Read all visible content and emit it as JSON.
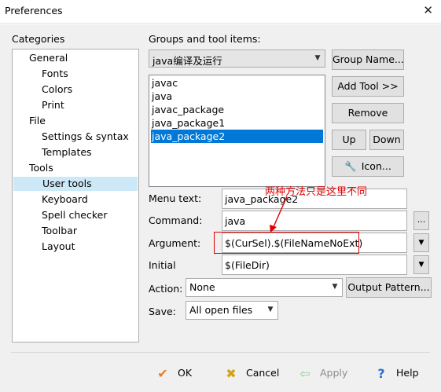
{
  "window": {
    "title": "Preferences",
    "close_glyph": "✕"
  },
  "categories": {
    "label": "Categories",
    "items": [
      {
        "label": "General",
        "level": 1
      },
      {
        "label": "Fonts",
        "level": 2
      },
      {
        "label": "Colors",
        "level": 2
      },
      {
        "label": "Print",
        "level": 2
      },
      {
        "label": "File",
        "level": 1
      },
      {
        "label": "Settings & syntax",
        "level": 2
      },
      {
        "label": "Templates",
        "level": 2
      },
      {
        "label": "Tools",
        "level": 1
      },
      {
        "label": "User tools",
        "level": 2,
        "selected": true
      },
      {
        "label": "Keyboard",
        "level": 2
      },
      {
        "label": "Spell checker",
        "level": 2
      },
      {
        "label": "Toolbar",
        "level": 2
      },
      {
        "label": "Layout",
        "level": 2
      }
    ]
  },
  "groups": {
    "label": "Groups and tool items:",
    "selected_group": "java编译及运行",
    "group_name_button": "Group Name...",
    "add_tool_button": "Add Tool >>",
    "remove_button": "Remove",
    "up_button": "Up",
    "down_button": "Down",
    "icon_button": "Icon...",
    "items": [
      {
        "label": "javac"
      },
      {
        "label": "java"
      },
      {
        "label": "javac_package"
      },
      {
        "label": "java_package1"
      },
      {
        "label": "java_package2",
        "selected": true
      }
    ]
  },
  "form": {
    "menu_text_label": "Menu text:",
    "menu_text_value": "java_package2",
    "command_label": "Command:",
    "command_value": "java",
    "command_browse": "...",
    "argument_label": "Argument:",
    "argument_value": "$(CurSel).$(FileNameNoExt)",
    "initial_label": "Initial",
    "initial_value": "$(FileDir)",
    "action_label": "Action:",
    "action_value": "None",
    "output_pattern_button": "Output Pattern...",
    "save_label": "Save:",
    "save_value": "All open files"
  },
  "annotation": {
    "text": "两种方法只是这里不同",
    "color": "#e00000"
  },
  "footer": {
    "ok": "OK",
    "cancel": "Cancel",
    "apply": "Apply",
    "help": "Help"
  }
}
